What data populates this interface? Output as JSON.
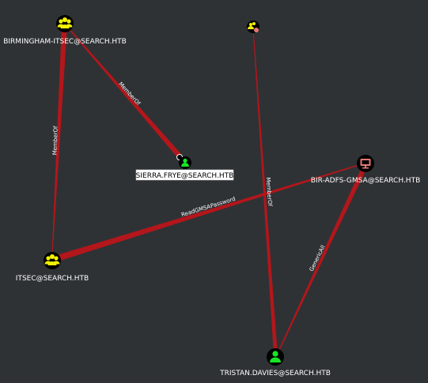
{
  "graph": {
    "colors": {
      "background": "#2e3235",
      "edge": "#b3161b",
      "group_node": "#f2f200",
      "user_node": "#17e625",
      "computer_node": "#e77873",
      "node_bg": "#000000"
    },
    "nodes": {
      "birmingham_itsec": {
        "label": "BIRMINGHAM-ITSEC@SEARCH.HTB",
        "type": "group",
        "icon": "group-icon"
      },
      "sierra_frye": {
        "label": "SIERRA.FRYE@SEARCH.HTB",
        "type": "user",
        "icon": "user-icon",
        "selected": true
      },
      "bir_adfs_gmsa": {
        "label": "BIR-ADFS-GMSA@SEARCH.HTB",
        "type": "computer",
        "icon": "monitor-icon"
      },
      "itsec": {
        "label": "ITSEC@SEARCH.HTB",
        "type": "group",
        "icon": "group-icon"
      },
      "tristan_davies": {
        "label": "TRISTAN.DAVIES@SEARCH.HTB",
        "type": "user",
        "icon": "user-icon"
      },
      "collapsed": {
        "label": "",
        "type": "group-cluster",
        "icon": "group-cluster-icon"
      }
    },
    "edges": {
      "e1": {
        "label": "MemberOf"
      },
      "e2": {
        "label": "MemberOf"
      },
      "e3": {
        "label": "ReadGMSAPassword"
      },
      "e4": {
        "label": "MemberOf"
      },
      "e5": {
        "label": "GenericAll"
      }
    }
  }
}
